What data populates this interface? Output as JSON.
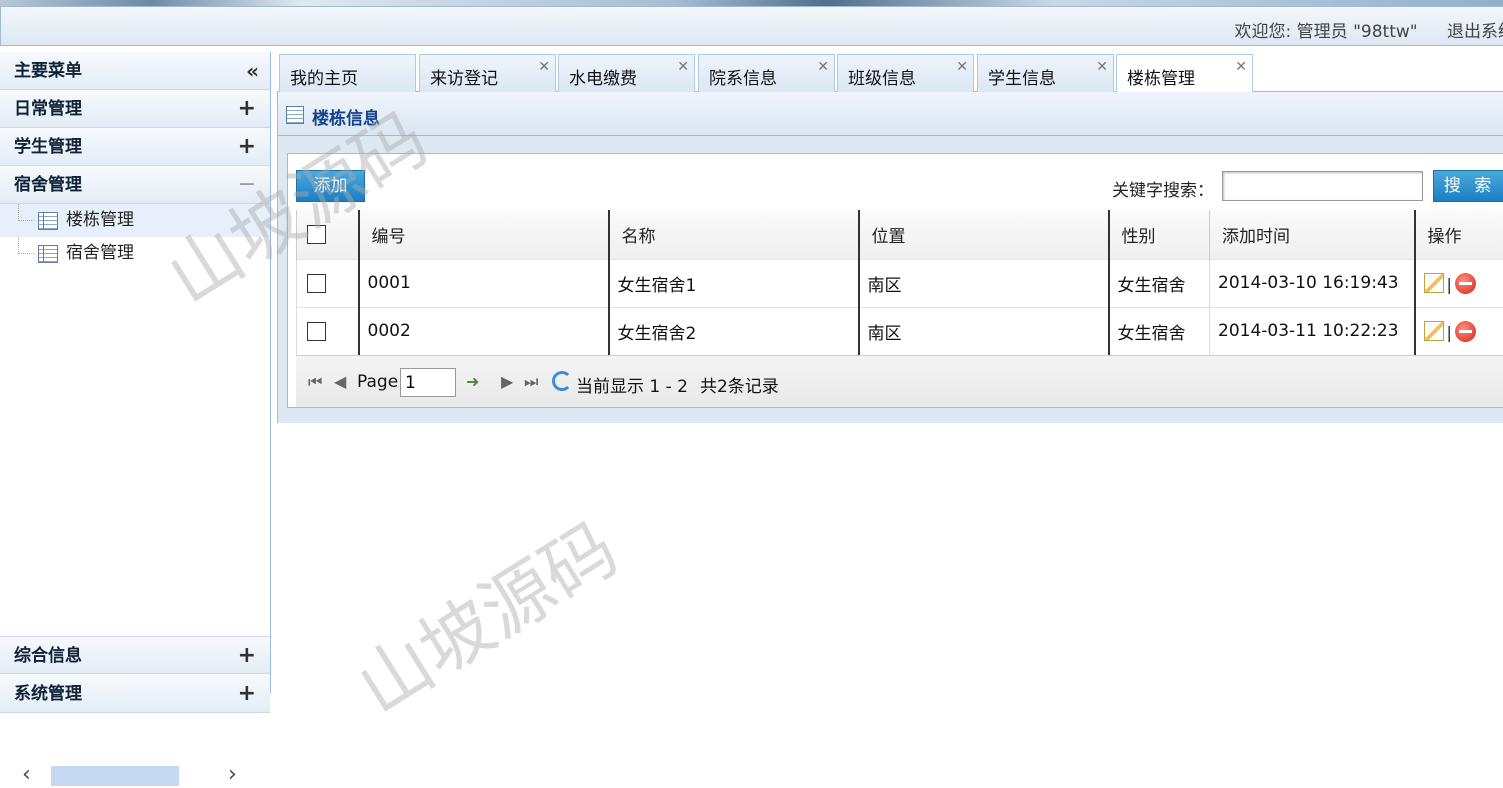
{
  "header": {
    "welcome_text": "欢迎您: 管理员 \"98ttw\"",
    "logout_label": "退出系统"
  },
  "sidebar": {
    "main_menu": "主要菜单",
    "sections": [
      {
        "label": "日常管理"
      },
      {
        "label": "学生管理"
      },
      {
        "label": "宿舍管理"
      }
    ],
    "tree_items": [
      {
        "label": "楼栋管理"
      },
      {
        "label": "宿舍管理"
      }
    ],
    "bottom_sections": [
      {
        "label": "综合信息"
      },
      {
        "label": "系统管理"
      }
    ]
  },
  "tabs": [
    {
      "label": "我的主页"
    },
    {
      "label": "来访登记"
    },
    {
      "label": "水电缴费"
    },
    {
      "label": "院系信息"
    },
    {
      "label": "班级信息"
    },
    {
      "label": "学生信息"
    },
    {
      "label": "楼栋管理"
    }
  ],
  "panel": {
    "title": "楼栋信息",
    "add_label": "添加",
    "search_label": "关键字搜索：",
    "search_value": "",
    "search_button": "搜 索"
  },
  "table": {
    "columns": [
      "编号",
      "名称",
      "位置",
      "性别",
      "添加时间",
      "操作"
    ],
    "rows": [
      {
        "id": "0001",
        "name": "女生宿舍1",
        "location": "南区",
        "gender": "女生宿舍",
        "time": "2014-03-10 16:19:43"
      },
      {
        "id": "0002",
        "name": "女生宿舍2",
        "location": "南区",
        "gender": "女生宿舍",
        "time": "2014-03-11 10:22:23"
      }
    ],
    "action_separator": "|"
  },
  "pager": {
    "page_label": "Page",
    "page_value": "1",
    "status": "当前显示 1 - 2",
    "total": "共2条记录"
  },
  "watermark": "山坡源码"
}
